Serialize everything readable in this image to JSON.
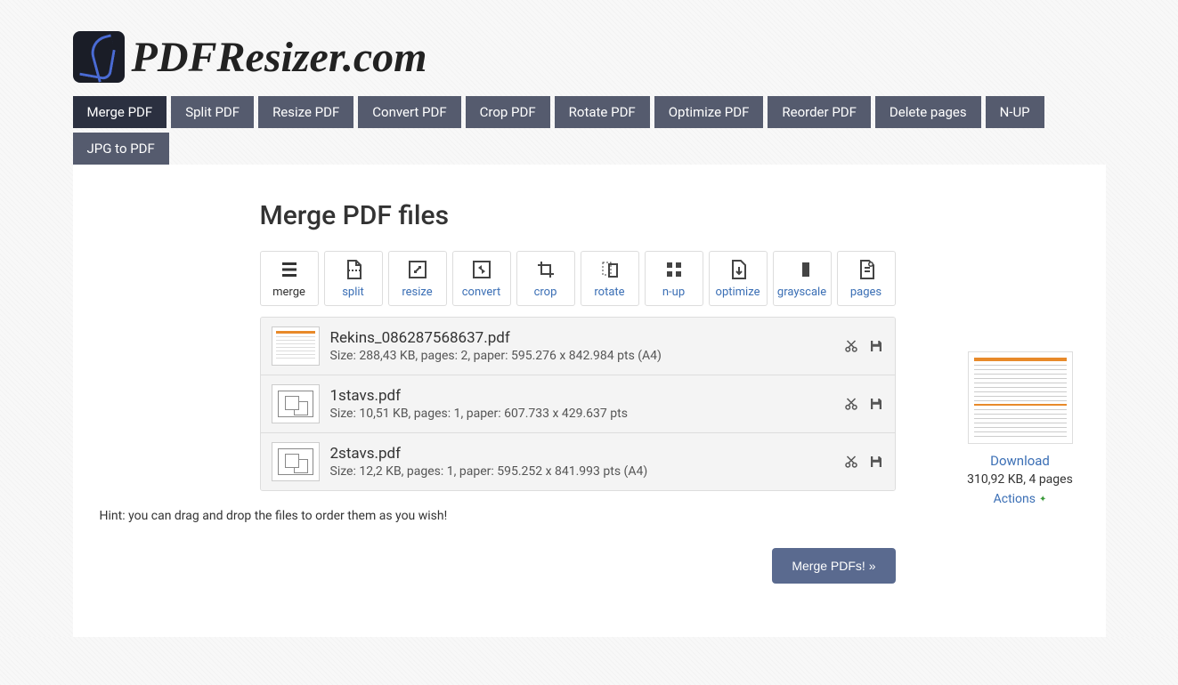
{
  "site": {
    "name": "PDFResizer.com"
  },
  "nav": [
    {
      "label": "Merge PDF",
      "active": true
    },
    {
      "label": "Split PDF"
    },
    {
      "label": "Resize PDF"
    },
    {
      "label": "Convert PDF"
    },
    {
      "label": "Crop PDF"
    },
    {
      "label": "Rotate PDF"
    },
    {
      "label": "Optimize PDF"
    },
    {
      "label": "Reorder PDF"
    },
    {
      "label": "Delete pages"
    },
    {
      "label": "N-UP"
    },
    {
      "label": "JPG to PDF"
    }
  ],
  "page_title": "Merge PDF files",
  "tools": [
    {
      "id": "merge",
      "label": "merge",
      "active": true
    },
    {
      "id": "split",
      "label": "split"
    },
    {
      "id": "resize",
      "label": "resize"
    },
    {
      "id": "convert",
      "label": "convert"
    },
    {
      "id": "crop",
      "label": "crop"
    },
    {
      "id": "rotate",
      "label": "rotate"
    },
    {
      "id": "nup",
      "label": "n-up"
    },
    {
      "id": "optimize",
      "label": "optimize"
    },
    {
      "id": "grayscale",
      "label": "grayscale"
    },
    {
      "id": "pages",
      "label": "pages"
    }
  ],
  "files": [
    {
      "name": "Rekins_086287568637.pdf",
      "meta": "Size: 288,43 KB, pages: 2, paper: 595.276 x 842.984 pts (A4)",
      "thumb": "doc"
    },
    {
      "name": "1stavs.pdf",
      "meta": "Size: 10,51 KB, pages: 1, paper: 607.733 x 429.637 pts",
      "thumb": "plan"
    },
    {
      "name": "2stavs.pdf",
      "meta": "Size: 12,2 KB, pages: 1, paper: 595.252 x 841.993 pts (A4)",
      "thumb": "plan"
    }
  ],
  "hint": "Hint: you can drag and drop the files to order them as you wish!",
  "merge_button": "Merge PDFs! »",
  "result": {
    "download_label": "Download",
    "meta": "310,92 KB, 4 pages",
    "actions_label": "Actions"
  }
}
